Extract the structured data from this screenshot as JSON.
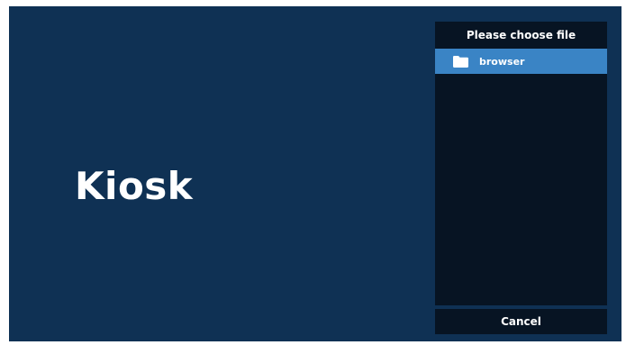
{
  "app": {
    "title": "Kiosk"
  },
  "file_chooser": {
    "header": "Please choose file",
    "items": [
      {
        "label": "browser",
        "icon": "folder-icon",
        "selected": true
      }
    ],
    "cancel_label": "Cancel"
  },
  "colors": {
    "background": "#0f3154",
    "panel": "#071423",
    "selection": "#3a84c5",
    "text": "#ffffff"
  }
}
